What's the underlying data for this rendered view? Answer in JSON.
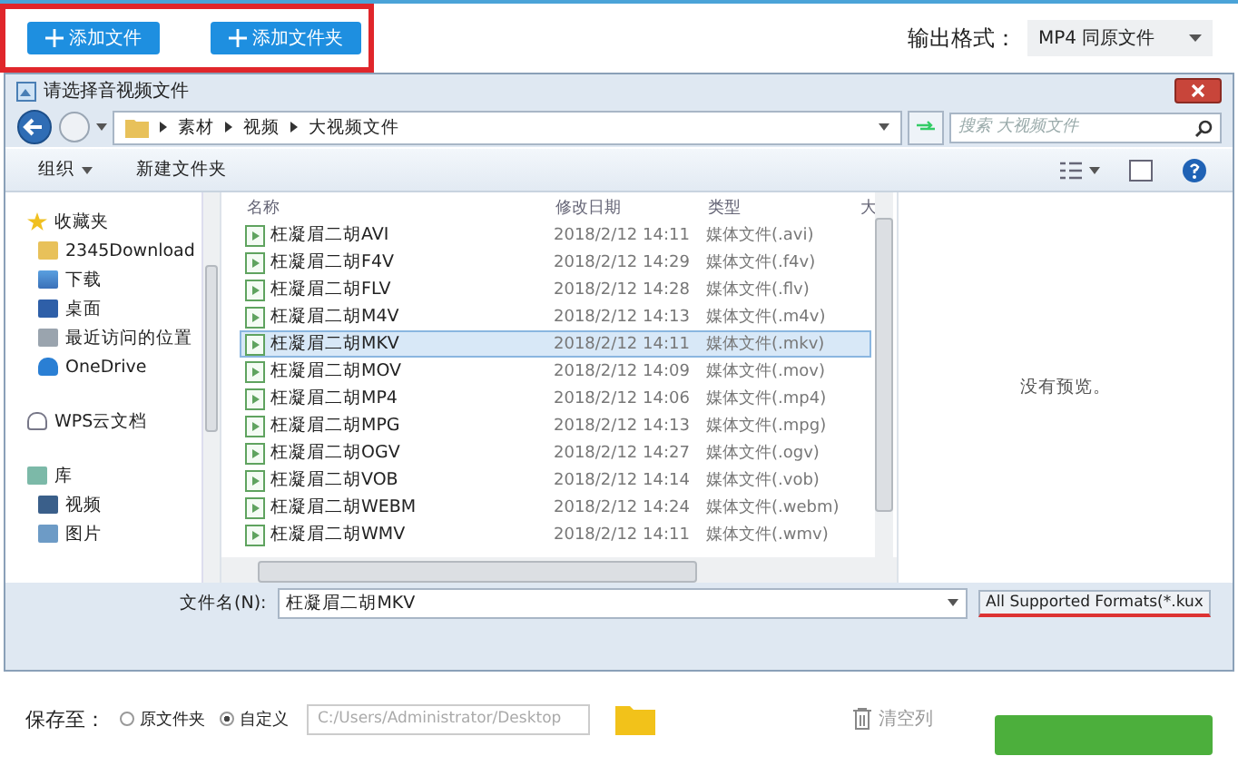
{
  "top": {
    "buttons": [
      {
        "label": "添加文件"
      },
      {
        "label": "添加文件夹"
      }
    ],
    "format_label": "输出格式：",
    "format_value": "MP4  同原文件"
  },
  "dialog": {
    "title": "请选择音视频文件",
    "breadcrumb": [
      "素材",
      "视频",
      "大视频文件"
    ],
    "search_placeholder": "搜索 大视频文件",
    "organize": "组织",
    "new_folder": "新建文件夹",
    "sidebar": [
      {
        "label": "收藏夹",
        "kind": "star",
        "children": [
          {
            "label": "2345Download",
            "kind": "folder"
          },
          {
            "label": "下载",
            "kind": "download"
          },
          {
            "label": "桌面",
            "kind": "desktop"
          },
          {
            "label": "最近访问的位置",
            "kind": "recent"
          },
          {
            "label": "OneDrive",
            "kind": "cloud"
          }
        ]
      },
      {
        "label": "WPS云文档",
        "kind": "cloud-outline"
      },
      {
        "label": "库",
        "kind": "library",
        "children": [
          {
            "label": "视频",
            "kind": "video"
          },
          {
            "label": "图片",
            "kind": "image"
          }
        ]
      }
    ],
    "columns": [
      "名称",
      "修改日期",
      "类型",
      "大"
    ],
    "rows": [
      {
        "name": "枉凝眉二胡AVI",
        "date": "2018/2/12 14:11",
        "type": "媒体文件(.avi)",
        "selected": false
      },
      {
        "name": "枉凝眉二胡F4V",
        "date": "2018/2/12 14:29",
        "type": "媒体文件(.f4v)",
        "selected": false
      },
      {
        "name": "枉凝眉二胡FLV",
        "date": "2018/2/12 14:28",
        "type": "媒体文件(.flv)",
        "selected": false
      },
      {
        "name": "枉凝眉二胡M4V",
        "date": "2018/2/12 14:13",
        "type": "媒体文件(.m4v)",
        "selected": false
      },
      {
        "name": "枉凝眉二胡MKV",
        "date": "2018/2/12 14:11",
        "type": "媒体文件(.mkv)",
        "selected": true
      },
      {
        "name": "枉凝眉二胡MOV",
        "date": "2018/2/12 14:09",
        "type": "媒体文件(.mov)",
        "selected": false
      },
      {
        "name": "枉凝眉二胡MP4",
        "date": "2018/2/12 14:06",
        "type": "媒体文件(.mp4)",
        "selected": false
      },
      {
        "name": "枉凝眉二胡MPG",
        "date": "2018/2/12 14:13",
        "type": "媒体文件(.mpg)",
        "selected": false
      },
      {
        "name": "枉凝眉二胡OGV",
        "date": "2018/2/12 14:27",
        "type": "媒体文件(.ogv)",
        "selected": false
      },
      {
        "name": "枉凝眉二胡VOB",
        "date": "2018/2/12 14:14",
        "type": "媒体文件(.vob)",
        "selected": false
      },
      {
        "name": "枉凝眉二胡WEBM",
        "date": "2018/2/12 14:24",
        "type": "媒体文件(.webm)",
        "selected": false
      },
      {
        "name": "枉凝眉二胡WMV",
        "date": "2018/2/12 14:11",
        "type": "媒体文件(.wmv)",
        "selected": false
      }
    ],
    "preview_text": "没有预览。",
    "filename_label": "文件名(N):",
    "filename": "枉凝眉二胡MKV",
    "filter": "All Supported Formats(*.kux"
  },
  "bottom": {
    "save_label": "保存至：",
    "radios": [
      {
        "label": "原文件夹",
        "selected": false
      },
      {
        "label": "自定义",
        "selected": true
      }
    ],
    "path": "C:/Users/Administrator/Desktop",
    "clear": "清空列"
  }
}
